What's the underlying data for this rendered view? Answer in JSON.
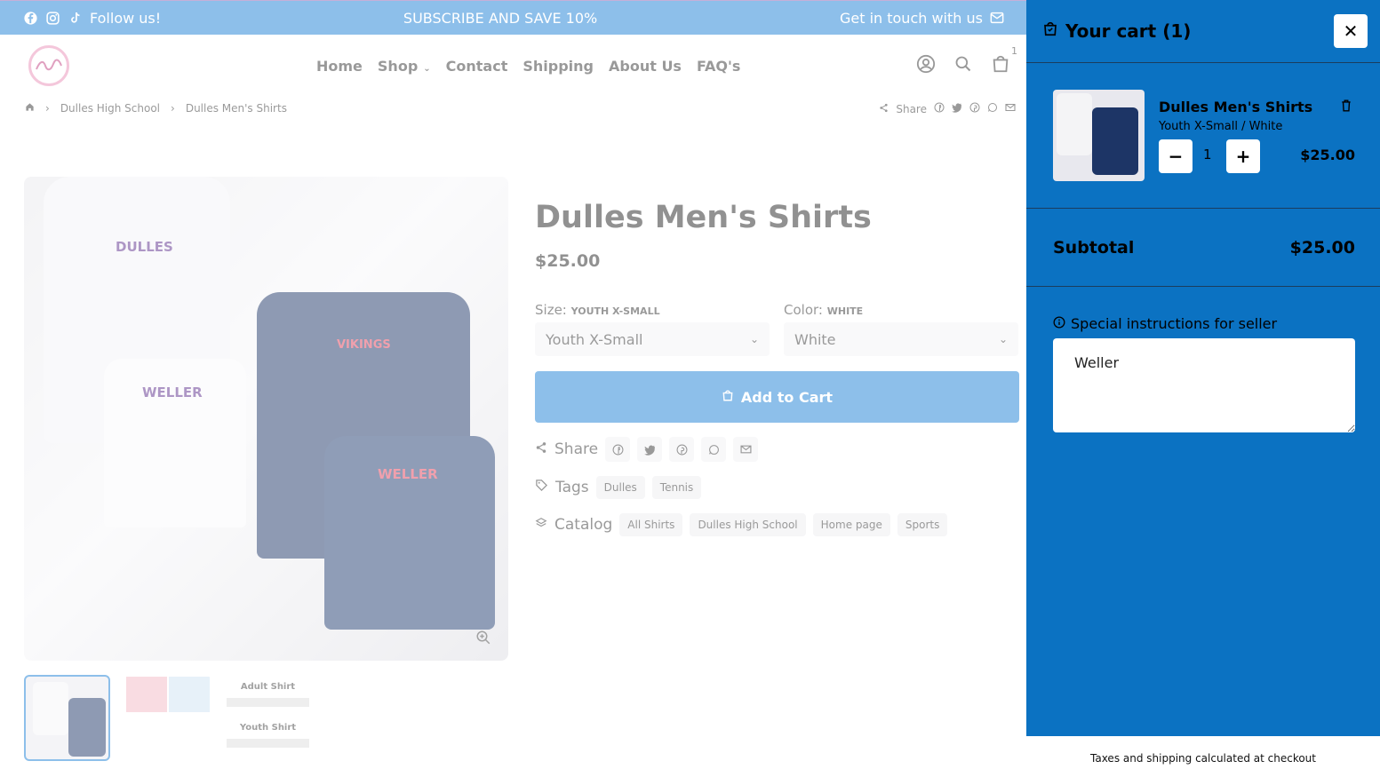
{
  "topbar": {
    "follow": "Follow us!",
    "promo": "SUBSCRIBE AND SAVE 10%",
    "contact": "Get in touch with us"
  },
  "nav": {
    "items": [
      "Home",
      "Shop",
      "Contact",
      "Shipping",
      "About Us",
      "FAQ's"
    ],
    "cart_count": "1"
  },
  "breadcrumb": {
    "items": [
      "Dulles High School",
      "Dulles Men's Shirts"
    ]
  },
  "share_label": "Share",
  "product": {
    "title": "Dulles Men's Shirts",
    "price": "$25.00",
    "size_label": "Size:",
    "size_value_caps": "YOUTH X-SMALL",
    "size_selected": "Youth X-Small",
    "color_label": "Color:",
    "color_value_caps": "WHITE",
    "color_selected": "White",
    "add_to_cart": "Add to Cart",
    "share": "Share",
    "tags_label": "Tags",
    "tags": [
      "Dulles",
      "Tennis"
    ],
    "catalog_label": "Catalog",
    "catalog": [
      "All Shirts",
      "Dulles High School",
      "Home page",
      "Sports"
    ]
  },
  "gallery": {
    "shirt_texts": [
      "DULLES",
      "WELLER",
      "VIKINGS",
      "WELLER"
    ],
    "thumb3_labels": [
      "Adult Shirt",
      "Youth Shirt"
    ]
  },
  "cart": {
    "title": "Your cart (1)",
    "item_name": "Dulles Men's Shirts",
    "item_variant": "Youth X-Small / White",
    "quantity": "1",
    "item_price": "$25.00",
    "subtotal_label": "Subtotal",
    "subtotal_value": "$25.00",
    "instructions_label": "Special instructions for seller",
    "instructions_value": "Weller",
    "footer_note": "Taxes and shipping calculated at checkout"
  },
  "colors": {
    "brand_blue": "#1a7fd4",
    "drawer_blue": "#0b72c2",
    "navy_shirt": "#1d3566"
  }
}
